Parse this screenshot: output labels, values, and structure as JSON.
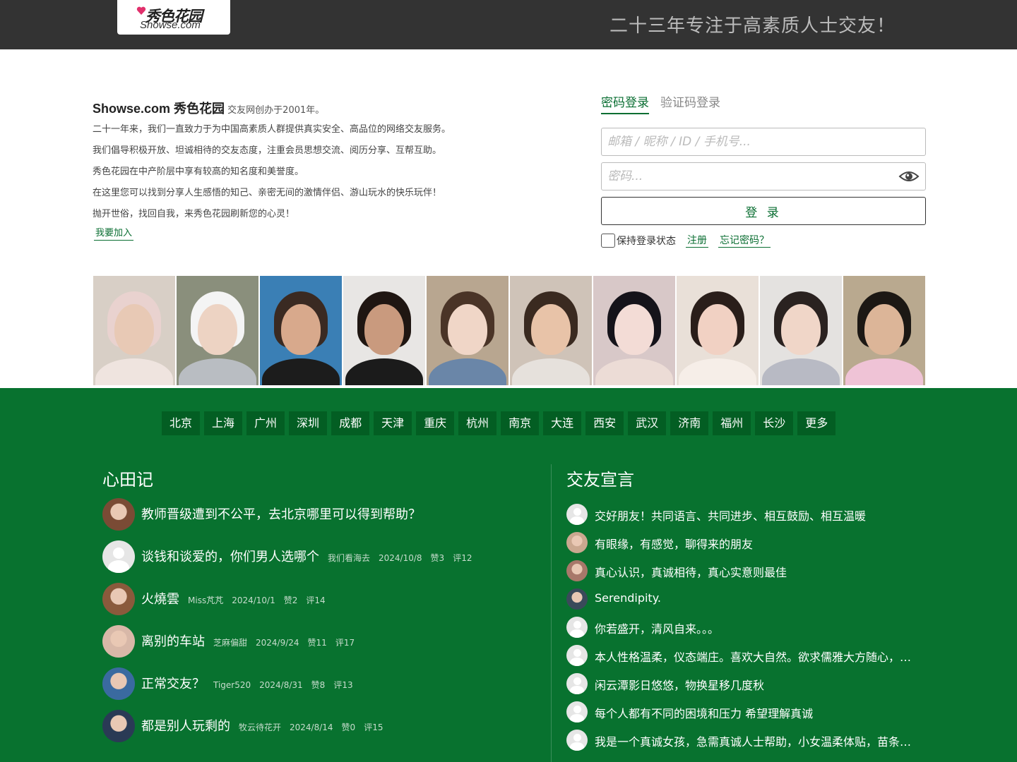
{
  "header": {
    "logo_cn": "秀色花园",
    "logo_en": "Showse.com",
    "slogan": "二十三年专注于高素质人士交友！"
  },
  "intro": {
    "site_name": "Showse.com 秀色花园",
    "founded": "交友网创办于2001年。",
    "lines": [
      "二十一年来，我们一直致力于为中国高素质人群提供真实安全、高品位的网络交友服务。",
      "我们倡导积极开放、坦诚相待的交友态度，注重会员思想交流、阅历分享、互帮互助。",
      "秀色花园在中产阶层中享有较高的知名度和美誉度。",
      "在这里您可以找到分享人生感悟的知己、亲密无间的激情伴侣、游山玩水的快乐玩伴！",
      "抛开世俗，找回自我，来秀色花园刷新您的心灵！"
    ],
    "join_link": "我要加入"
  },
  "login": {
    "tab_password": "密码登录",
    "tab_code": "验证码登录",
    "user_placeholder": "邮箱 / 昵称 / ID / 手机号...",
    "pass_placeholder": "密码...",
    "submit": "登 录",
    "keep_login": "保持登录状态",
    "register": "注册",
    "forgot": "忘记密码？"
  },
  "photos": [
    {
      "bg": "#d8cfc6",
      "hair": "#e9d2cf",
      "face": "#e8c9b5",
      "body": "#efe4df"
    },
    {
      "bg": "#8a8f7c",
      "hair": "#f4f4f4",
      "face": "#edd3c3",
      "body": "#b9bdc2"
    },
    {
      "bg": "#3a7fb5",
      "hair": "#3a2a22",
      "face": "#d8a98c",
      "body": "#1c1c1c"
    },
    {
      "bg": "#e8e6e4",
      "hair": "#1f1612",
      "face": "#c99a7e",
      "body": "#1b1b1b"
    },
    {
      "bg": "#b8a690",
      "hair": "#4a3427",
      "face": "#f0d6c7",
      "body": "#6a86a8"
    },
    {
      "bg": "#cfc3b8",
      "hair": "#3a2a20",
      "face": "#e8c3a8",
      "body": "#e6e1dc"
    },
    {
      "bg": "#d8c8c8",
      "hair": "#15131a",
      "face": "#f3dcd6",
      "body": "#ecdcd6"
    },
    {
      "bg": "#e9e0d8",
      "hair": "#2a1e1a",
      "face": "#f1d1c3",
      "body": "#f6eee8"
    },
    {
      "bg": "#e4e2e0",
      "hair": "#2a2220",
      "face": "#f0d6c8",
      "body": "#b8bac4"
    },
    {
      "bg": "#b9a98f",
      "hair": "#1c1814",
      "face": "#dcb598",
      "body": "#efc3d6"
    }
  ],
  "cities": [
    "北京",
    "上海",
    "广州",
    "深圳",
    "成都",
    "天津",
    "重庆",
    "杭州",
    "南京",
    "大连",
    "西安",
    "武汉",
    "济南",
    "福州",
    "长沙",
    "更多"
  ],
  "diaries": {
    "title": "心田记",
    "items": [
      {
        "title": "教师晋级遭到不公平，去北京哪里可以得到帮助？",
        "author": "",
        "date": "",
        "likes": "",
        "comments": "",
        "avatar": "photo",
        "avatar_color": "#7a4b35"
      },
      {
        "title": "谈钱和谈爱的，你们男人选哪个",
        "author": "我们看海去",
        "date": "2024/10/8",
        "likes": "赞3",
        "comments": "评12",
        "avatar": "default",
        "avatar_color": "#e6e6e6"
      },
      {
        "title": "火燒雲",
        "author": "Miss芃芃",
        "date": "2024/10/1",
        "likes": "赞2",
        "comments": "评14",
        "avatar": "photo",
        "avatar_color": "#8a5a3c"
      },
      {
        "title": "离别的车站",
        "author": "芝麻偏甜",
        "date": "2024/9/24",
        "likes": "赞11",
        "comments": "评17",
        "avatar": "photo",
        "avatar_color": "#d8b8a8"
      },
      {
        "title": "正常交友？",
        "author": "Tiger520",
        "date": "2024/8/31",
        "likes": "赞8",
        "comments": "评13",
        "avatar": "photo",
        "avatar_color": "#3a6aa0"
      },
      {
        "title": "都是别人玩剩的",
        "author": "牧云待花开",
        "date": "2024/8/14",
        "likes": "赞0",
        "comments": "评15",
        "avatar": "photo",
        "avatar_color": "#2a3a55"
      }
    ]
  },
  "declarations": {
    "title": "交友宣言",
    "items": [
      {
        "text": "交好朋友！共同语言、共同进步、相互鼓励、相互温暖",
        "avatar": "default",
        "avatar_color": "#e6e6e6"
      },
      {
        "text": "有眼缘，有感觉，聊得来的朋友",
        "avatar": "photo",
        "avatar_color": "#caa890"
      },
      {
        "text": "真心认识，真诚相待，真心实意则最佳",
        "avatar": "photo",
        "avatar_color": "#a8786a"
      },
      {
        "text": "Serendipity.",
        "avatar": "photo",
        "avatar_color": "#3a4a5a"
      },
      {
        "text": "你若盛开，清风自来。。。",
        "avatar": "default",
        "avatar_color": "#e6e6e6"
      },
      {
        "text": "本人性格温柔，仪态端庄。喜欢大自然。欲求儒雅大方随心，身心健康的男士",
        "avatar": "default",
        "avatar_color": "#e6e6e6"
      },
      {
        "text": "闲云潭影日悠悠，物换星移几度秋",
        "avatar": "default",
        "avatar_color": "#e6e6e6"
      },
      {
        "text": "每个人都有不同的困境和压力 希望理解真诚",
        "avatar": "default",
        "avatar_color": "#e6e6e6"
      },
      {
        "text": "我是一个真诚女孩，急需真诚人士帮助，小女温柔体贴，苗条可人",
        "avatar": "default",
        "avatar_color": "#e6e6e6"
      }
    ]
  },
  "colors": {
    "brand_green": "#08722f",
    "city_button": "#035e23",
    "topbar": "#333333",
    "link_green": "#0a6e32"
  }
}
